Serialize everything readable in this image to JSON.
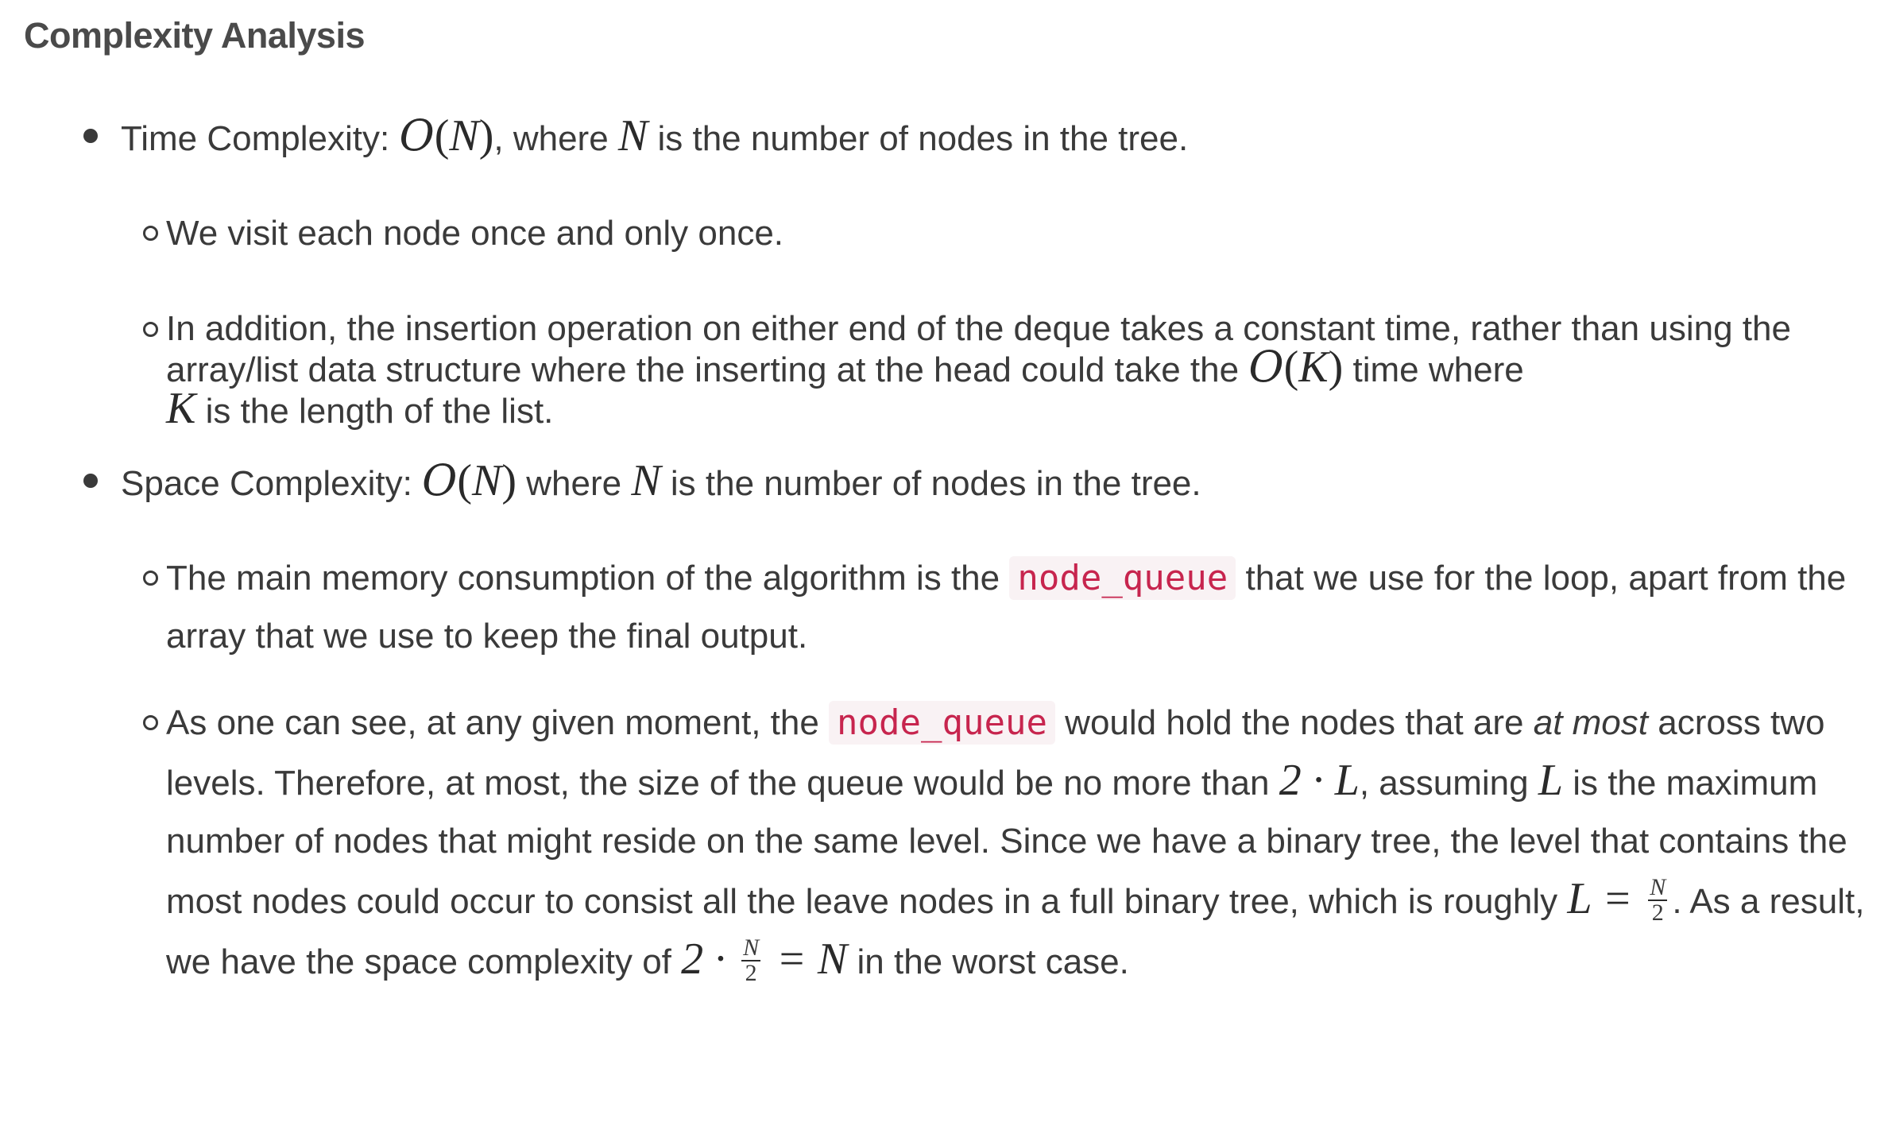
{
  "heading": "Complexity Analysis",
  "time": {
    "label": "Time Complexity: ",
    "big_o": "O",
    "var_n": "N",
    "mid": ", where ",
    "var_n2": "N",
    "tail": " is the number of nodes in the tree.",
    "sub1": "We visit each node once and only once.",
    "sub2_a": "In addition, the insertion operation on either end of the deque takes a constant time, rather than using the array/list data structure where the inserting at the head could take the ",
    "sub2_o": "O",
    "sub2_k": "K",
    "sub2_b": " time where ",
    "sub2_k2": "K",
    "sub2_c": " is the length of the list."
  },
  "space": {
    "label": "Space Complexity: ",
    "big_o": "O",
    "var_n": "N",
    "mid": " where ",
    "var_n2": "N",
    "tail": " is the number of nodes in the tree.",
    "sub1_a": "The main memory consumption of the algorithm is the ",
    "code": "node_queue",
    "sub1_b": " that we use for the loop, apart from the array that we use to keep the final output.",
    "sub2_a": "As one can see, at any given moment, the ",
    "sub2_code": "node_queue",
    "sub2_b": " would hold the nodes that are ",
    "sub2_em": "at most",
    "sub2_c": " across two levels. Therefore, at most, the size of the queue would be no more than ",
    "sub2_m1": "2 · L",
    "sub2_d": ", assuming ",
    "sub2_l": "L",
    "sub2_e": " is the maximum number of nodes that might reside on the same level. Since we have a binary tree, the level that contains the most nodes could occur to consist all the leave nodes in a full binary tree, which is roughly ",
    "sub2_m2": "L = ",
    "frac_num": "N",
    "frac_den": "2",
    "sub2_f": ". As a result, we have the space complexity of ",
    "sub2_m3": "2 · ",
    "frac2_num": "N",
    "frac2_den": "2",
    "sub2_m4": " = N",
    "sub2_g": " in the worst case."
  }
}
